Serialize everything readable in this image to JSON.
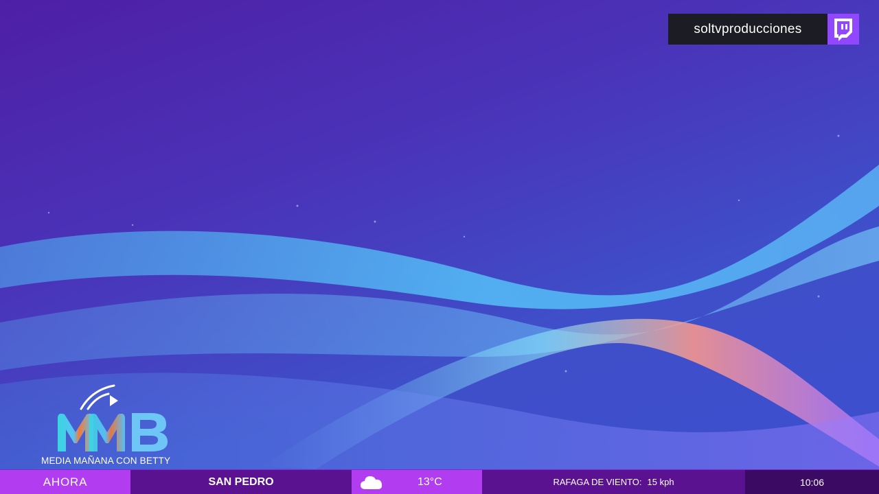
{
  "stream": {
    "channel_name": "soltvproducciones",
    "platform_icon": "twitch-icon",
    "platform_color": "#9147ff"
  },
  "logo": {
    "mark": "MMB",
    "caption": "MEDIA MAÑANA CON BETTY",
    "icon": "play-broadcast-icon"
  },
  "ticker": {
    "now_label": "AHORA",
    "city": "SAN PEDRO",
    "weather_icon": "cloud-icon",
    "temperature": "13°C",
    "wind_label": "RAFAGA DE VIENTO:",
    "wind_value": "15 kph",
    "time": "10:06"
  },
  "colors": {
    "background_top": "#4e1fa6",
    "background_bottom": "#3e4fd0",
    "ticker_accent": "#b23cf0",
    "ticker_dark": "#5a1291",
    "ticker_darkest": "#3b0a62"
  }
}
